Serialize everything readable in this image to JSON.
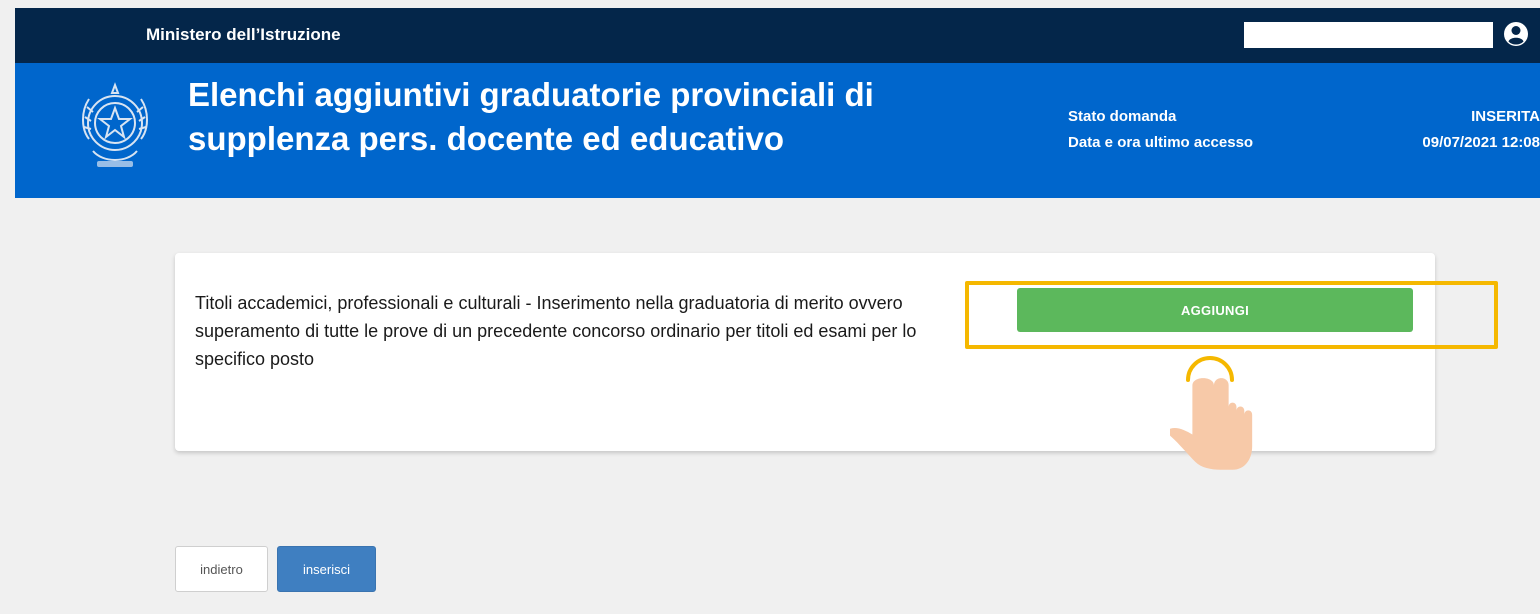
{
  "topbar": {
    "ministry": "Ministero dell’Istruzione",
    "user_icon": "user-circle-icon"
  },
  "header": {
    "emblem_icon": "italian-republic-emblem-icon",
    "title": "Elenchi aggiuntivi graduatorie provinciali di supplenza pers. docente ed educativo",
    "status_label": "Stato domanda",
    "status_value": "INSERITA",
    "last_access_label": "Data e ora ultimo accesso",
    "last_access_value": "09/07/2021 12:08"
  },
  "card": {
    "description": "Titoli accademici, professionali e culturali - Inserimento nella graduatoria di merito ovvero superamento di tutte le prove di un precedente concorso ordinario per titoli ed esami per lo specifico posto",
    "add_label": "AGGIUNGI"
  },
  "annotation": {
    "highlight_color": "#f5b800",
    "pointer_icon": "tap-hand-icon"
  },
  "footer": {
    "back_label": "indietro",
    "insert_label": "inserisci"
  },
  "colors": {
    "topbar": "#04264a",
    "header": "#0066cc",
    "add_button": "#5cb85c",
    "insert_button": "#3f7fc1"
  }
}
